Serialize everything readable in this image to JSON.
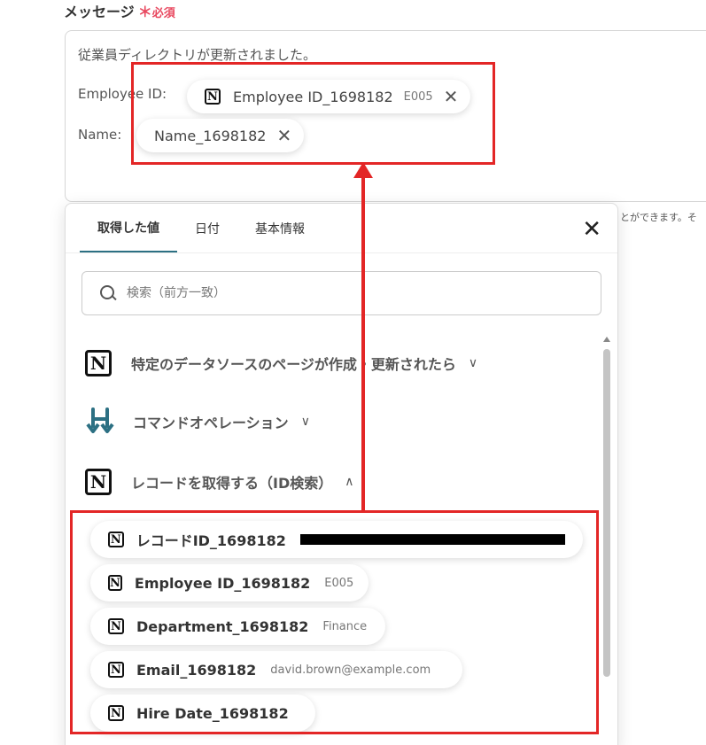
{
  "field": {
    "label": "メッセージ",
    "required_mark": "＊",
    "required_text": "必須"
  },
  "message": {
    "line1": "従業員ディレクトリが更新されました。",
    "employee_label": "Employee ID:",
    "name_label": "Name:",
    "employee_pill": {
      "label": "Employee ID_1698182",
      "value": "E005",
      "remove": "✕"
    },
    "name_pill": {
      "label": "Name_1698182",
      "remove": "✕"
    }
  },
  "hint": "とができます。そ",
  "panel": {
    "tabs": [
      {
        "label": "取得した値",
        "active": true
      },
      {
        "label": "日付",
        "active": false
      },
      {
        "label": "基本情報",
        "active": false
      }
    ],
    "close": "✕",
    "search_placeholder": "検索（前方一致）",
    "sections": [
      {
        "title": "特定のデータソースのページが作成・更新されたら",
        "chevron": "∨",
        "icon": "notion-icon"
      },
      {
        "title": "コマンドオペレーション",
        "chevron": "∨",
        "icon": "command-operation-icon"
      },
      {
        "title": "レコードを取得する（ID検索）",
        "chevron": "∧",
        "icon": "notion-icon"
      }
    ],
    "items": [
      {
        "name": "レコードID_1698182",
        "value": ""
      },
      {
        "name": "Employee ID_1698182",
        "value": "E005"
      },
      {
        "name": "Department_1698182",
        "value": "Finance"
      },
      {
        "name": "Email_1698182",
        "value": "david.brown@example.com"
      },
      {
        "name": "Hire Date_1698182",
        "value": ""
      }
    ]
  },
  "notion_letter": "N",
  "colors": {
    "accent": "#2c7083",
    "required": "#e8485f",
    "annotation": "#e32626",
    "command_icon": "#2c7083"
  }
}
